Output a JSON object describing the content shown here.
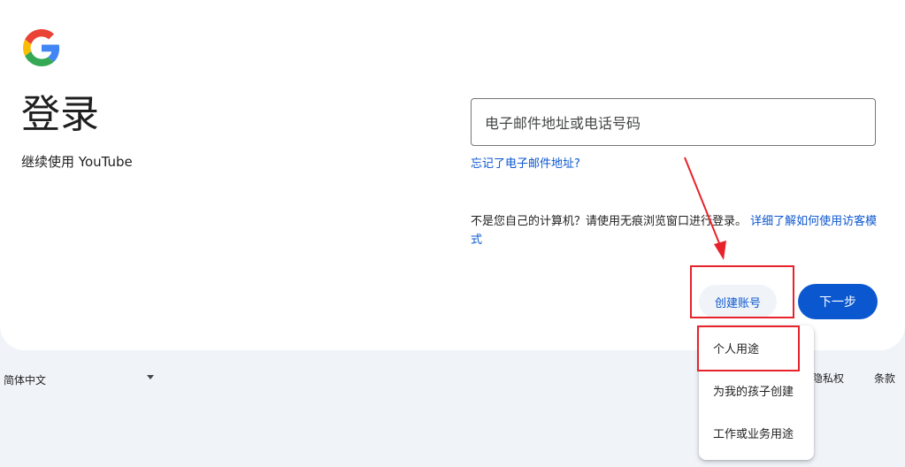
{
  "header": {
    "logo_icon": "google-g-logo",
    "title": "登录",
    "subtitle": "继续使用 YouTube"
  },
  "form": {
    "email_placeholder": "电子邮件地址或电话号码",
    "forgot_email": "忘记了电子邮件地址?",
    "notice_text": "不是您自己的计算机？请使用无痕浏览窗口进行登录。",
    "learn_more": "详细了解如何使用访客模式"
  },
  "actions": {
    "create_account": "创建账号",
    "next": "下一步"
  },
  "create_menu": {
    "items": [
      "个人用途",
      "为我的孩子创建",
      "工作或业务用途"
    ]
  },
  "footer": {
    "language": "简体中文",
    "links": [
      "隐私权",
      "条款"
    ]
  },
  "colors": {
    "primary": "#0b57d0",
    "annotation_red": "#e8222b",
    "page_background": "#f0f4f9"
  }
}
